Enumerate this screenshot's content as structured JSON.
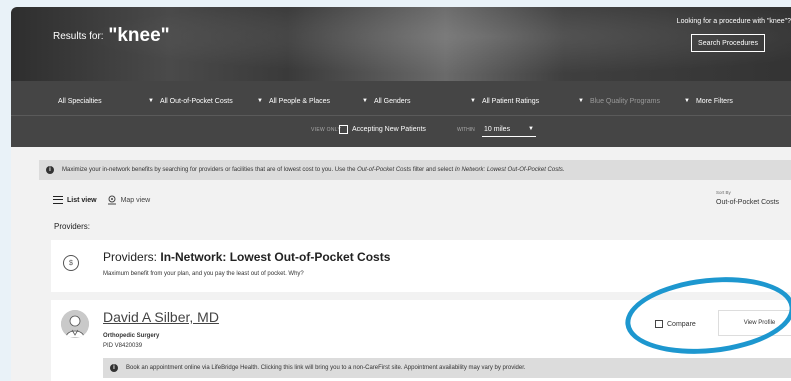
{
  "header": {
    "results_prefix": "Results for:",
    "query": "\"knee\"",
    "procedure_question": "Looking for a procedure with \"knee\"?",
    "search_procedures_label": "Search Procedures"
  },
  "filters": [
    {
      "label": "All Specialties"
    },
    {
      "label": "All Out-of-Pocket Costs"
    },
    {
      "label": "All People & Places"
    },
    {
      "label": "All Genders"
    },
    {
      "label": "All Patient Ratings"
    },
    {
      "label": "Blue Quality Programs"
    },
    {
      "label": "More Filters"
    }
  ],
  "subfilters": {
    "view_only_label": "VIEW ONLY",
    "accepting_label": "Accepting New Patients",
    "within_label": "WITHIN",
    "distance_value": "10 miles"
  },
  "banner": {
    "text_a": "Maximize your in-network benefits by searching for providers or facilities that are of lowest cost to you. Use the ",
    "text_b": "Out-of-Pocket Costs",
    "text_c": " filter and select ",
    "text_d": "In Network: Lowest Out-Of-Pocket Costs",
    "text_e": "."
  },
  "views": {
    "list_label": "List view",
    "map_label": "Map view"
  },
  "sort": {
    "label": "Sort By",
    "value": "Out-of-Pocket Costs"
  },
  "providers_label": "Providers:",
  "tier_card": {
    "dollar_symbol": "$",
    "title_prefix": "Providers: ",
    "title_bold": "In-Network: Lowest Out-of-Pocket Costs",
    "subtitle": "Maximum benefit from your plan, and you pay the least out of pocket. Why?"
  },
  "provider": {
    "name": "David A Silber, MD",
    "specialty": "Orthopedic Surgery",
    "pid": "PID V8420039",
    "compare_label": "Compare",
    "view_profile_label": "View Profile",
    "booking_note": "Book an appointment online via LifeBridge Health. Clicking this link will bring you to a non-CareFirst site. Appointment availability may vary by provider."
  },
  "colors": {
    "accent_circle": "#1d97cf",
    "filter_bar": "#454545"
  }
}
